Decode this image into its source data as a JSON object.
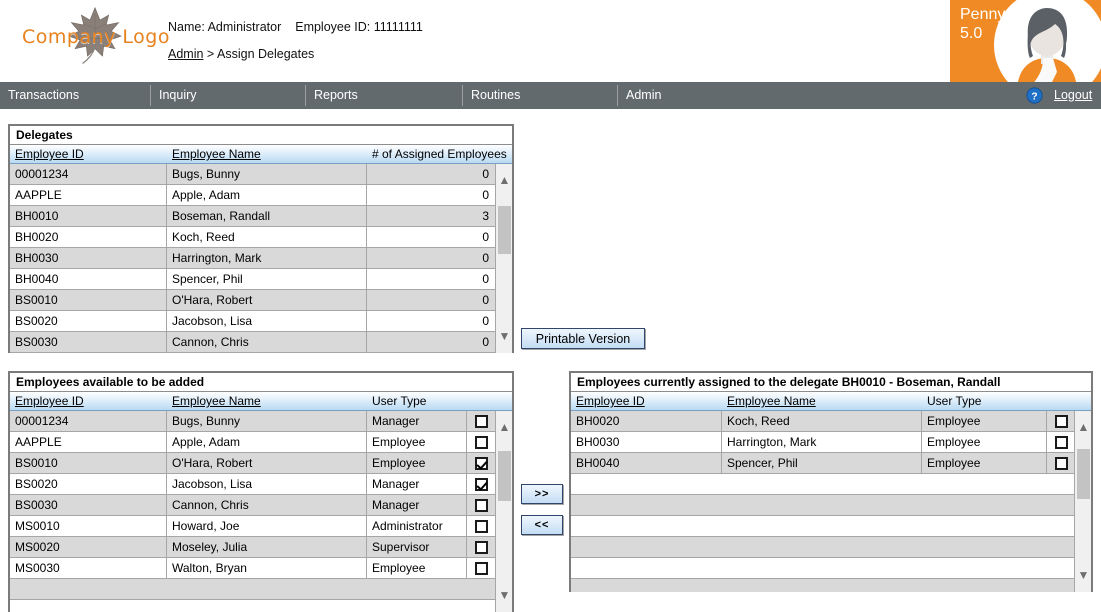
{
  "header": {
    "logo_text": "Company Logo",
    "logo_icon": "maple-leaf-icon",
    "name_label": "Name: Administrator",
    "employee_id_label": "Employee ID: 11111111",
    "breadcrumb_root": "Admin",
    "breadcrumb_sep": ">",
    "breadcrumb_current": "Assign Delegates",
    "penny_line1": "Penny",
    "penny_line2": "5.0",
    "accent_color": "#F08A24",
    "nav_bg_color": "#636a6e"
  },
  "nav": {
    "items": [
      {
        "label": "Transactions"
      },
      {
        "label": "Inquiry"
      },
      {
        "label": "Reports"
      },
      {
        "label": "Routines"
      },
      {
        "label": "Admin"
      }
    ],
    "help_label": "?",
    "logout_label": "Logout"
  },
  "delegates": {
    "title": "Delegates",
    "columns": [
      "Employee ID",
      "Employee Name",
      "# of Assigned Employees"
    ],
    "rows": [
      {
        "id": "00001234",
        "name": "Bugs, Bunny",
        "count": "0"
      },
      {
        "id": "AAPPLE",
        "name": "Apple, Adam",
        "count": "0"
      },
      {
        "id": "BH0010",
        "name": "Boseman, Randall",
        "count": "3"
      },
      {
        "id": "BH0020",
        "name": "Koch, Reed",
        "count": "0"
      },
      {
        "id": "BH0030",
        "name": "Harrington, Mark",
        "count": "0"
      },
      {
        "id": "BH0040",
        "name": "Spencer, Phil",
        "count": "0"
      },
      {
        "id": "BS0010",
        "name": "O'Hara, Robert",
        "count": "0"
      },
      {
        "id": "BS0020",
        "name": "Jacobson, Lisa",
        "count": "0"
      },
      {
        "id": "BS0030",
        "name": "Cannon, Chris",
        "count": "0"
      }
    ]
  },
  "printable_button": "Printable Version",
  "transfer": {
    "add_label": ">>",
    "remove_label": "<<"
  },
  "available": {
    "title": "Employees available to be added",
    "columns": [
      "Employee ID",
      "Employee Name",
      "User Type"
    ],
    "rows": [
      {
        "id": "00001234",
        "name": "Bugs, Bunny",
        "type": "Manager",
        "checked": false
      },
      {
        "id": "AAPPLE",
        "name": "Apple, Adam",
        "type": "Employee",
        "checked": false
      },
      {
        "id": "BS0010",
        "name": "O'Hara, Robert",
        "type": "Employee",
        "checked": true
      },
      {
        "id": "BS0020",
        "name": "Jacobson, Lisa",
        "type": "Manager",
        "checked": true
      },
      {
        "id": "BS0030",
        "name": "Cannon, Chris",
        "type": "Manager",
        "checked": false
      },
      {
        "id": "MS0010",
        "name": "Howard, Joe",
        "type": "Administrator",
        "checked": false
      },
      {
        "id": "MS0020",
        "name": "Moseley, Julia",
        "type": "Supervisor",
        "checked": false
      },
      {
        "id": "MS0030",
        "name": "Walton, Bryan",
        "type": "Employee",
        "checked": false
      },
      {
        "id": "",
        "name": "",
        "type": "",
        "checked": null
      }
    ]
  },
  "assigned": {
    "title": "Employees currently assigned to the delegate BH0010 - Boseman, Randall",
    "columns": [
      "Employee ID",
      "Employee Name",
      "User Type"
    ],
    "rows": [
      {
        "id": "BH0020",
        "name": "Koch, Reed",
        "type": "Employee",
        "checked": false
      },
      {
        "id": "BH0030",
        "name": "Harrington, Mark",
        "type": "Employee",
        "checked": false
      },
      {
        "id": "BH0040",
        "name": "Spencer, Phil",
        "type": "Employee",
        "checked": false
      },
      {
        "id": "",
        "name": "",
        "type": "",
        "checked": null
      },
      {
        "id": "",
        "name": "",
        "type": "",
        "checked": null
      },
      {
        "id": "",
        "name": "",
        "type": "",
        "checked": null
      },
      {
        "id": "",
        "name": "",
        "type": "",
        "checked": null
      },
      {
        "id": "",
        "name": "",
        "type": "",
        "checked": null
      },
      {
        "id": "",
        "name": "",
        "type": "",
        "checked": null
      }
    ]
  }
}
